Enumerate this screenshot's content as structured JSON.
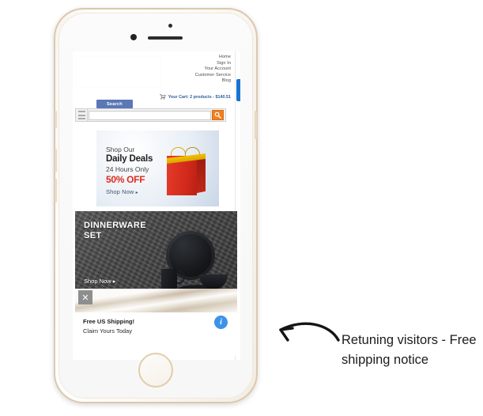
{
  "annotation": {
    "text": "Retuning visitors - Free shipping notice",
    "arrow_icon": "curved-arrow-left-icon"
  },
  "device": {
    "name": "smartphone-mockup",
    "frame_color": "#dcc8ad",
    "body_color": "#f7f3ee"
  },
  "screen": {
    "header": {
      "logo_alt": "",
      "nav_links": [
        {
          "label": "Home"
        },
        {
          "label": "Sign In"
        },
        {
          "label": "Your Account"
        },
        {
          "label": "Customer Service"
        },
        {
          "label": "Blog"
        }
      ],
      "cart": {
        "icon": "shopping-cart-icon",
        "text": "Your Cart: 2 products - $140.51",
        "product_count": 2,
        "total": "$140.51",
        "color": "#2c5f9e"
      },
      "search": {
        "tab_label": "Search",
        "tab_color": "#5b77b5",
        "placeholder": "",
        "value": "",
        "button_icon": "magnifier-icon",
        "button_color": "#f08020",
        "menu_icon": "hamburger-menu-icon"
      }
    },
    "deals_banner": {
      "line1": "Shop Our",
      "line2": "Daily Deals",
      "line3": "24 Hours Only",
      "line4": "50% OFF",
      "cta": "Shop Now",
      "cta_arrow": "▸",
      "discount_color": "#e02b20",
      "art": "red-gift-bag-image"
    },
    "dinnerware_banner": {
      "title_line1": "DINNERWARE",
      "title_line2": "SET",
      "cta": "Shop Now",
      "cta_arrow": "▸",
      "art": "black-dinnerware-set-image"
    },
    "notification": {
      "close_icon": "close-x-icon",
      "close_glyph": "✕",
      "title": "Free US Shipping!",
      "subtitle": "Claim Yours Today",
      "info_icon": "info-circle-icon",
      "info_glyph": "i",
      "info_color": "#3d93e8"
    },
    "scroll_indicator": "scrollbar-thumb"
  }
}
